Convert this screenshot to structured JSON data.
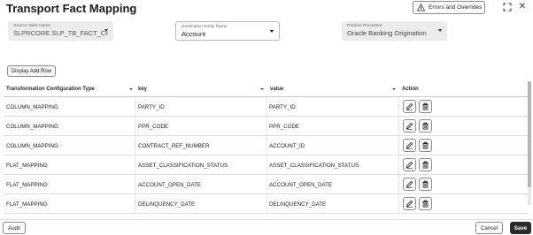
{
  "page_title": "Transport Fact Mapping",
  "header": {
    "errors_button": "Errors and Overrides",
    "icons": [
      "warning-icon",
      "expand-icon",
      "close-icon"
    ]
  },
  "fields": {
    "source_table": {
      "label": "Source Table Name",
      "value": "SLPRCORE.SLP_TB_FACT_CH"
    },
    "destination_entity": {
      "label": "Destination Entity Name",
      "value": "Account"
    },
    "product_processor": {
      "label": "Product Processor",
      "value": "Oracle Banking Origination"
    }
  },
  "display_add_row": "Display Add Row",
  "table": {
    "columns": [
      "Transformation Configuration Type",
      "key",
      "value",
      "Action"
    ],
    "rows": [
      {
        "type": "COLUMN_MAPPING",
        "key": "PARTY_ID",
        "value": "PARTY_ID"
      },
      {
        "type": "COLUMN_MAPPING",
        "key": "PPR_CODE",
        "value": "PPR_CODE"
      },
      {
        "type": "COLUMN_MAPPING",
        "key": "CONTRACT_REF_NUMBER",
        "value": "ACCOUNT_ID"
      },
      {
        "type": "FLAT_MAPPING",
        "key": "ASSET_CLASSIFICATION_STATUS",
        "value": "ASSET_CLASSIFICATION_STATUS"
      },
      {
        "type": "FLAT_MAPPING",
        "key": "ACCOUNT_OPEN_DATE",
        "value": "ACCOUNT_OPEN_DATE"
      },
      {
        "type": "FLAT_MAPPING",
        "key": "DELINQUENCY_DATE",
        "value": "DELINQUENCY_DATE"
      }
    ],
    "action_icons": [
      "edit-icon",
      "delete-icon"
    ]
  },
  "footer": {
    "audit": "Audit",
    "cancel": "Cancel",
    "save": "Save"
  }
}
